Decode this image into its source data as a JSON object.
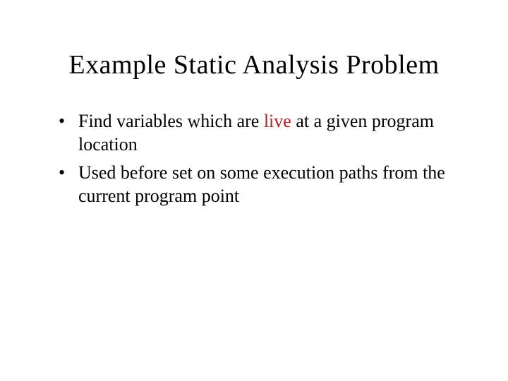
{
  "title": "Example Static Analysis Problem",
  "bullets": [
    {
      "prefix": "Find variables which are ",
      "highlight": "live",
      "suffix": " at a given program location"
    },
    {
      "prefix": "Used before set on some execution paths from the current program point",
      "highlight": "",
      "suffix": ""
    }
  ],
  "colors": {
    "highlight": "#b22222",
    "text": "#000000",
    "background": "#ffffff"
  }
}
